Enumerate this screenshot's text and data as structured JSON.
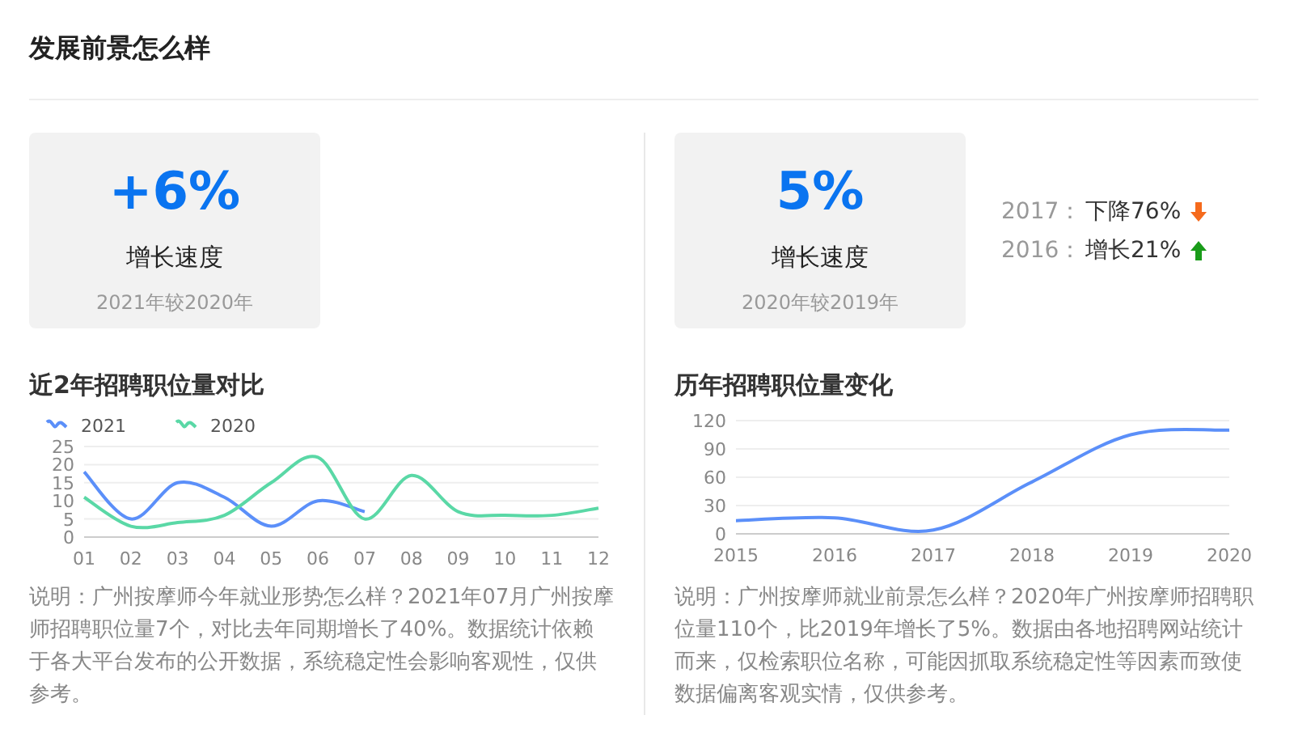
{
  "title": "发展前景怎么样",
  "left": {
    "card": {
      "value": "+6%",
      "label": "增长速度",
      "caption": "2021年较2020年"
    },
    "chart_title": "近2年招聘职位量对比",
    "chart_data": {
      "type": "line",
      "categories": [
        "01",
        "02",
        "03",
        "04",
        "05",
        "06",
        "07",
        "08",
        "09",
        "10",
        "11",
        "12"
      ],
      "yticks": [
        0,
        5,
        10,
        15,
        20,
        25
      ],
      "ylim": [
        0,
        25
      ],
      "grid": true,
      "series": [
        {
          "name": "2021",
          "color": "#5b8ff9",
          "values": [
            18,
            5,
            15,
            11,
            3,
            10,
            7,
            null,
            null,
            null,
            null,
            null
          ]
        },
        {
          "name": "2020",
          "color": "#5ad8a6",
          "values": [
            11,
            3,
            4,
            6,
            15,
            22,
            5,
            17,
            7,
            6,
            6,
            8
          ]
        }
      ]
    },
    "note": "说明：广州按摩师今年就业形势怎么样？2021年07月广州按摩师招聘职位量7个，对比去年同期增长了40%。数据统计依赖于各大平台发布的公开数据，系统稳定性会影响客观性，仅供参考。"
  },
  "right": {
    "card": {
      "value": "5%",
      "label": "增长速度",
      "caption": "2020年较2019年"
    },
    "stats": [
      {
        "year": "2017：",
        "change": "下降76%",
        "kind": "down"
      },
      {
        "year": "2016：",
        "change": "增长21%",
        "kind": "up"
      }
    ],
    "chart_title": "历年招聘职位量变化",
    "chart_data": {
      "type": "line",
      "categories": [
        "2015",
        "2016",
        "2017",
        "2018",
        "2019",
        "2020"
      ],
      "yticks": [
        0,
        30,
        60,
        90,
        120
      ],
      "ylim": [
        0,
        120
      ],
      "grid": true,
      "series": [
        {
          "color": "#5b8ff9",
          "values": [
            14,
            17,
            4,
            55,
            105,
            110
          ]
        }
      ]
    },
    "note": "说明：广州按摩师就业前景怎么样？2020年广州按摩师招聘职位量110个，比2019年增长了5%。数据由各地招聘网站统计而来，仅检索职位名称，可能因抓取系统稳定性等因素而致使数据偏离客观实情，仅供参考。"
  }
}
